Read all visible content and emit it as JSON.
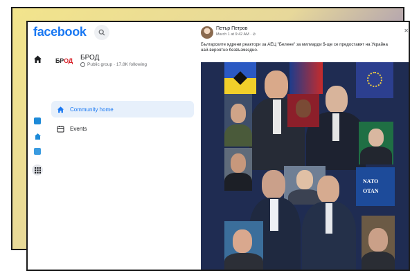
{
  "colors": {
    "brand": "#1877f2",
    "active_bg": "#e7f0fb",
    "backdrop_yellow": "#f2e48c",
    "backdrop_purple": "#5c5aa8",
    "image_bg": "#1f2c52"
  },
  "header": {
    "logo": "facebook",
    "search_icon": "search-icon"
  },
  "rail": {
    "icons": [
      "home-icon",
      "video-icon",
      "marketplace-icon",
      "gaming-icon",
      "menu-grid-icon"
    ]
  },
  "group": {
    "logo_text_a": "БР",
    "logo_text_b": "ОД",
    "name": "БРОД",
    "meta": "Public group · 17.8K following",
    "nav": [
      {
        "label": "Community home",
        "icon": "home-icon",
        "active": true
      },
      {
        "label": "Events",
        "icon": "calendar-icon",
        "active": false
      }
    ]
  },
  "post": {
    "author": "Петър Петров",
    "timestamp": "March 1 at 9:42 AM · ⊘",
    "text_line1": "Българските ядрени реактори за АЕЦ \"Белене\" за милиарди $-ще се предоставят на Украйна",
    "text_line2": "най-вероятно безвъзмездно.",
    "close_icon": "close-icon",
    "image_flag_text": [
      "NATO",
      "OTAN"
    ]
  }
}
